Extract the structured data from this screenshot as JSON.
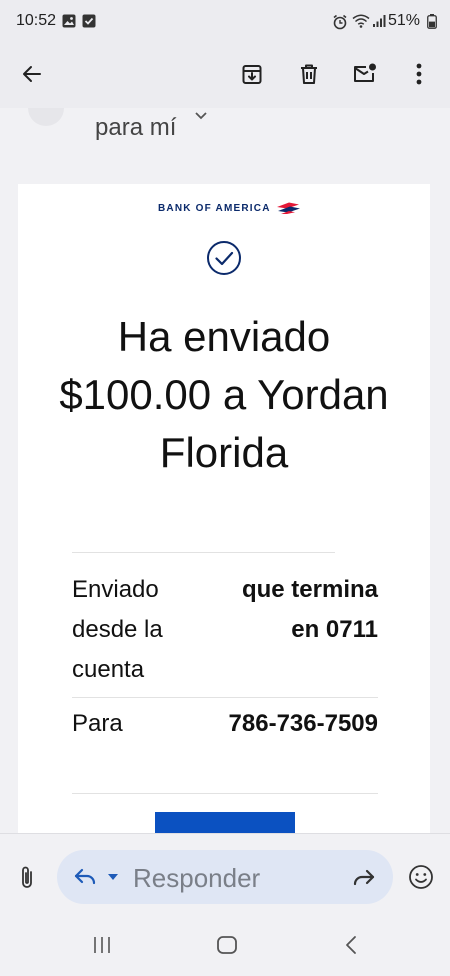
{
  "status": {
    "time": "10:52",
    "battery": "51%",
    "icons": [
      "image-icon",
      "checkbox-icon",
      "alarm-icon",
      "wifi-icon",
      "signal-icon",
      "battery-icon"
    ]
  },
  "toolbar": {
    "icons": [
      "back-arrow-icon",
      "archive-icon",
      "delete-icon",
      "mark-unread-icon",
      "more-icon"
    ]
  },
  "email": {
    "recipient": "para mí",
    "bank_name": "BANK OF AMERICA",
    "headline": "Ha enviado $100.00 a Yordan Florida",
    "rows": [
      {
        "label": "Enviado desde la cuenta",
        "value": "que termina en 0711"
      },
      {
        "label": "Para",
        "value": "786-736-7509"
      }
    ]
  },
  "compose": {
    "reply_placeholder": "Responder"
  },
  "colors": {
    "brand_blue": "#0b51c1",
    "brand_navy": "#0b2a6b",
    "brand_red": "#e31837",
    "reply_pill": "#dfe6f4"
  }
}
